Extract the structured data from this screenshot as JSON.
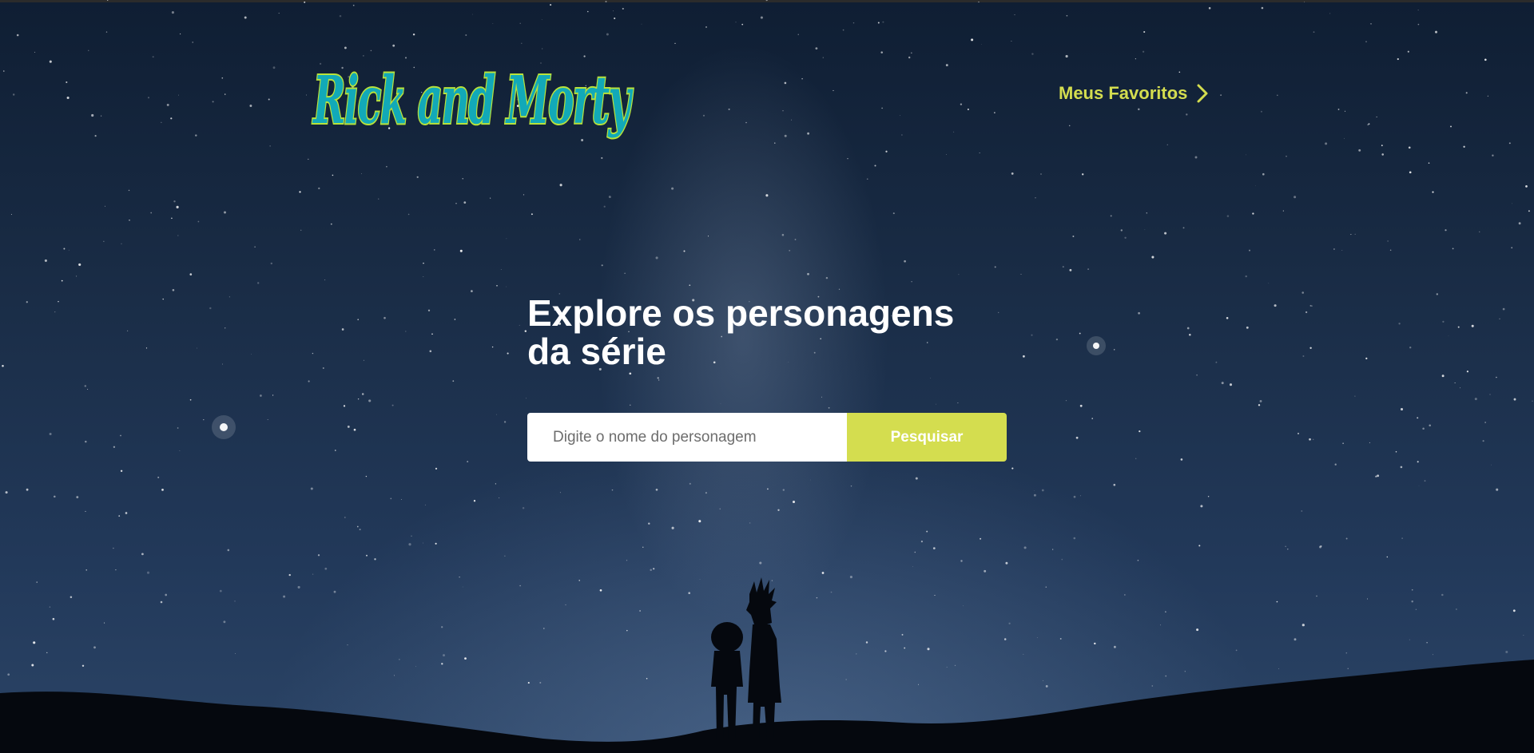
{
  "brand": {
    "logo_text": "Rick and Morty",
    "logo_colors": {
      "fill": "#12a9b8",
      "outline": "#b9e23a"
    }
  },
  "nav": {
    "favorites_label": "Meus Favoritos",
    "favorites_icon": "chevron-right-icon"
  },
  "hero": {
    "title": "Explore os personagens da série"
  },
  "search": {
    "placeholder": "Digite o nome do personagem",
    "value": "",
    "button_label": "Pesquisar"
  },
  "colors": {
    "accent": "#d4dd4f",
    "background_top": "#0f1e33",
    "background_bottom": "#2b4466"
  }
}
